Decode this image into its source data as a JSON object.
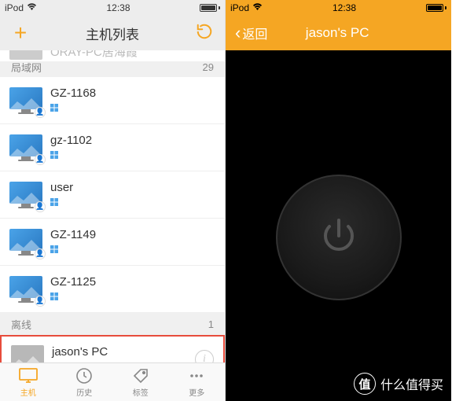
{
  "status": {
    "device": "iPod",
    "time": "12:38"
  },
  "left": {
    "nav_title": "主机列表",
    "partial_host": "ORAY-PC居海霞",
    "sections": {
      "online": {
        "label": "局域网",
        "count": "29"
      },
      "offline": {
        "label": "离线",
        "count": "1"
      }
    },
    "hosts_online": [
      {
        "name": "GZ-1168"
      },
      {
        "name": "gz-1102"
      },
      {
        "name": "user"
      },
      {
        "name": "GZ-1149"
      },
      {
        "name": "GZ-1125"
      }
    ],
    "hosts_offline": [
      {
        "name": "jason's PC"
      }
    ],
    "tabs": [
      {
        "label": "主机"
      },
      {
        "label": "历史"
      },
      {
        "label": "标签"
      },
      {
        "label": "更多"
      }
    ]
  },
  "right": {
    "back_label": "返回",
    "nav_title": "jason's PC"
  },
  "watermark": "什么值得买",
  "watermark_badge": "值"
}
